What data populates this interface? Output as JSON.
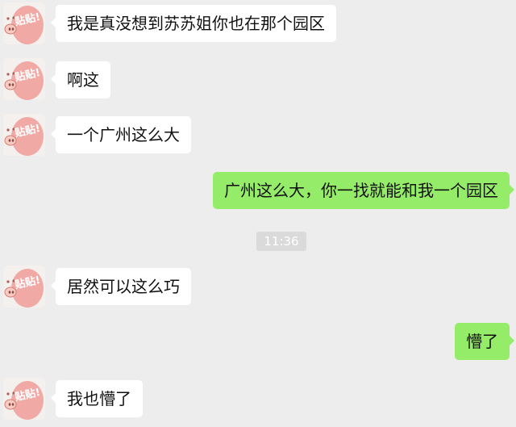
{
  "colors": {
    "background": "#ededed",
    "incoming_bubble": "#ffffff",
    "outgoing_bubble": "#95ec69",
    "timestamp_bg": "#dadada"
  },
  "contact": {
    "avatar_icon": "pig-sticker-avatar-icon",
    "avatar_caption": "贴贴!"
  },
  "messages": [
    {
      "side": "left",
      "text": "我是真没想到苏苏姐你也在那个园区"
    },
    {
      "side": "left",
      "text": "啊这"
    },
    {
      "side": "left",
      "text": "一个广州这么大"
    },
    {
      "side": "right",
      "text": "广州这么大，你一找就能和我一个园区"
    },
    {
      "side": "left",
      "text": "居然可以这么巧"
    },
    {
      "side": "right",
      "text": "懵了"
    },
    {
      "side": "left",
      "text": "我也懵了"
    }
  ],
  "timestamp": "11:36"
}
